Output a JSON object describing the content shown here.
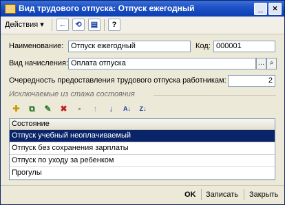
{
  "window": {
    "title": "Вид трудового отпуска: Отпуск ежегодный"
  },
  "toolbar": {
    "actions_label": "Действия",
    "actions_arrow": "▾"
  },
  "form": {
    "name_label": "Наименование:",
    "name_value": "Отпуск ежегодный",
    "code_label": "Код:",
    "code_value": "000001",
    "accrual_label": "Вид начисления:",
    "accrual_value": "Оплата отпуска",
    "order_label": "Очередность предоставления трудового отпуска работникам:",
    "order_value": "2"
  },
  "group": {
    "title": "Исключаемые из стажа состояния"
  },
  "table": {
    "header": "Состояние",
    "rows": [
      "Отпуск учебный неоплачиваемый",
      "Отпуск без сохранения зарплаты",
      "Отпуск по уходу за ребенком",
      "Прогулы"
    ],
    "selected_row": 0
  },
  "footer": {
    "ok_label": "OK",
    "save_label": "Записать",
    "close_label": "Закрыть"
  },
  "colors": {
    "titlebar": "#0b3db3",
    "selection": "#0a246a",
    "window_bg": "#ece9d8"
  },
  "icons": [
    "window-icon",
    "minimize-icon",
    "close-icon",
    "back-arrow-icon",
    "refresh-icon",
    "document-icon",
    "help-icon",
    "ellipsis-icon",
    "search-icon",
    "add-row-icon",
    "copy-row-icon",
    "edit-row-icon",
    "delete-row-icon",
    "end-edit-icon",
    "move-up-icon",
    "move-down-icon",
    "sort-asc-icon",
    "sort-desc-icon"
  ]
}
